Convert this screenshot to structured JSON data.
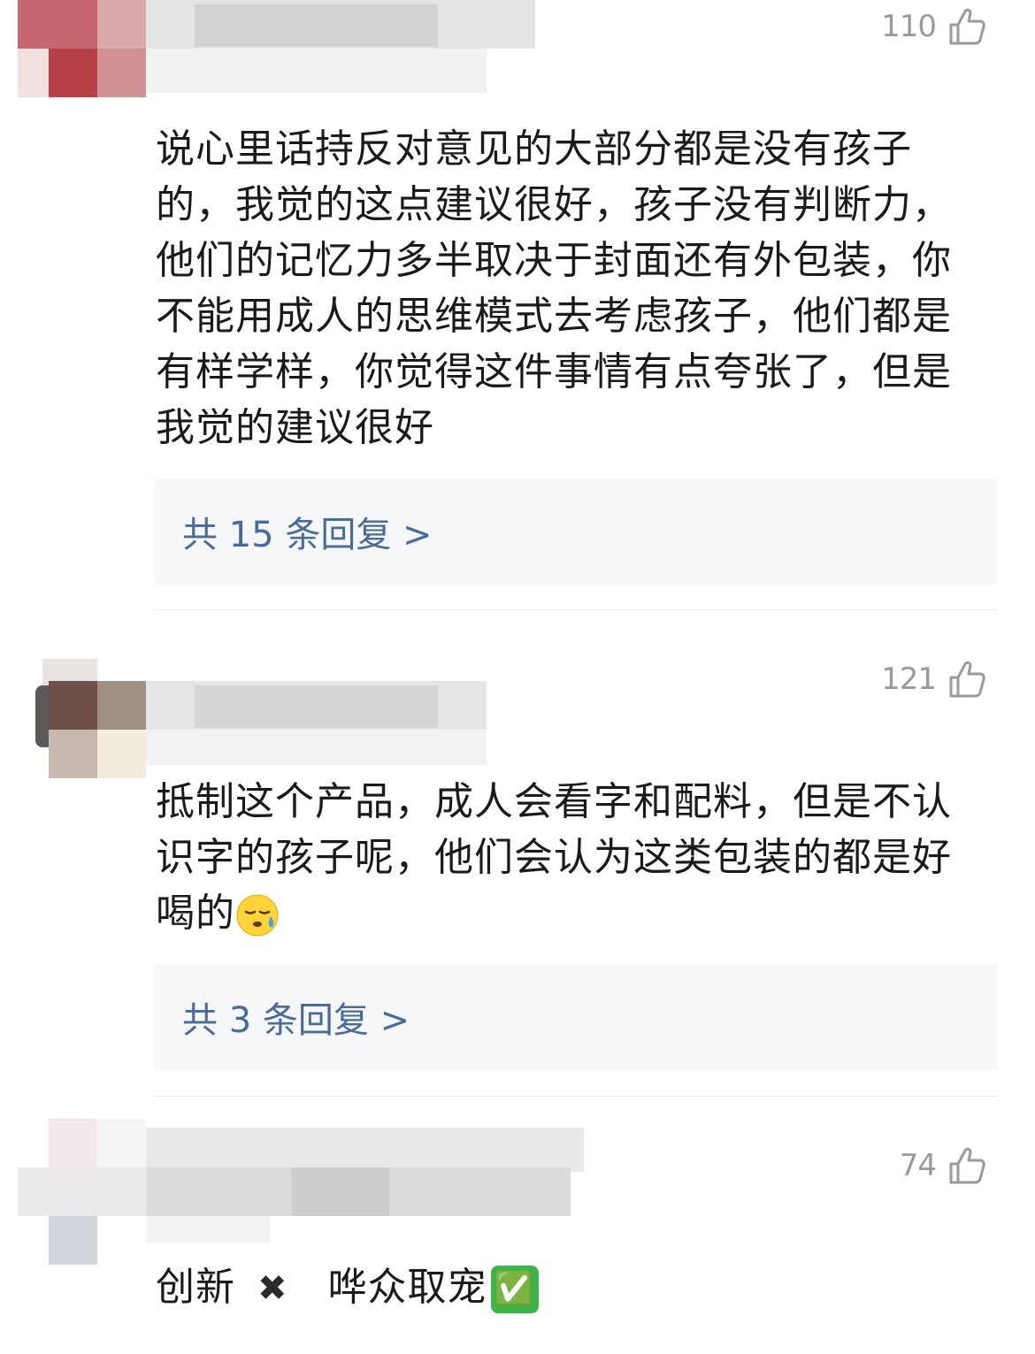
{
  "comments": [
    {
      "likes": "110",
      "text": "说心里话持反对意见的大部分都是没有孩子的，我觉的这点建议很好，孩子没有判断力，他们的记忆力多半取决于封面还有外包装，你不能用成人的思维模式去考虑孩子，他们都是有样学样，你觉得这件事情有点夸张了，但是我觉的建议很好",
      "replies_label": "共 15 条回复 >"
    },
    {
      "likes": "121",
      "text": "抵制这个产品，成人会看字和配料，但是不认识字的孩子呢，他们会认为这类包装的都是好喝的",
      "emoji": "sweat-face",
      "replies_label": "共 3 条回复 >"
    },
    {
      "likes": "74",
      "text_part1": "创新",
      "mark1": "✖",
      "text_part2": "哗众取宠",
      "mark2": "✅"
    }
  ],
  "icons": {
    "like": "thumbs-up-outline-icon"
  },
  "colors": {
    "reply_link": "#4a6b97",
    "reply_bg": "#f6f7f8",
    "like_count": "#9a9a9a",
    "check_green": "#3cb64a"
  }
}
